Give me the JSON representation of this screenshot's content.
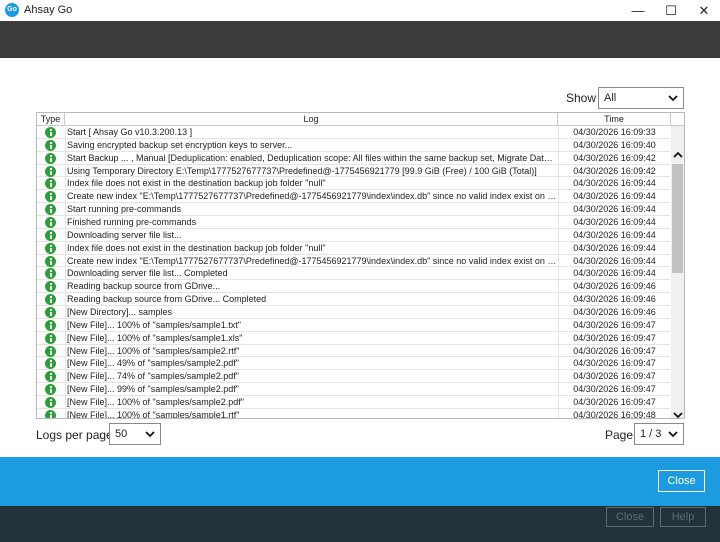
{
  "window": {
    "title": "Ahsay Go",
    "icon_text": "Go",
    "min_glyph": "—",
    "max_glyph": "☐",
    "close_glyph": "✕"
  },
  "filter": {
    "show_label": "Show",
    "show_value": "All"
  },
  "table": {
    "headers": {
      "type": "Type",
      "log": "Log",
      "time": "Time"
    },
    "rows": [
      {
        "message": "Start [ Ahsay Go v10.3.200.13 ]",
        "time": "04/30/2026 16:09:33"
      },
      {
        "message": "Saving encrypted backup set encryption keys to server...",
        "time": "04/30/2026 16:09:40"
      },
      {
        "message": "Start Backup ... , Manual [Deduplication: enabled, Deduplication scope: All files within the same backup set, Migrate Data: ...",
        "time": "04/30/2026 16:09:42"
      },
      {
        "message": "Using Temporary Directory E:\\Temp\\1777527677737\\Predefined@-1775456921779 [99.9 GiB (Free) / 100 GiB (Total)]",
        "time": "04/30/2026 16:09:42"
      },
      {
        "message": "Index file does not exist in the destination backup job folder \"null\"",
        "time": "04/30/2026 16:09:44"
      },
      {
        "message": "Create new index \"E:\\Temp\\1777527677737\\Predefined@-1775456921779\\index\\index.db\" since no valid index exist on b...",
        "time": "04/30/2026 16:09:44"
      },
      {
        "message": "Start running pre-commands",
        "time": "04/30/2026 16:09:44"
      },
      {
        "message": "Finished running pre-commands",
        "time": "04/30/2026 16:09:44"
      },
      {
        "message": "Downloading server file list...",
        "time": "04/30/2026 16:09:44"
      },
      {
        "message": "Index file does not exist in the destination backup job folder \"null\"",
        "time": "04/30/2026 16:09:44"
      },
      {
        "message": "Create new index \"E:\\Temp\\1777527677737\\Predefined@-1775456921779\\index\\index.db\" since no valid index exist on b...",
        "time": "04/30/2026 16:09:44"
      },
      {
        "message": "Downloading server file list... Completed",
        "time": "04/30/2026 16:09:44"
      },
      {
        "message": "Reading backup source from GDrive...",
        "time": "04/30/2026 16:09:46"
      },
      {
        "message": "Reading backup source from GDrive... Completed",
        "time": "04/30/2026 16:09:46"
      },
      {
        "message": "[New Directory]... samples",
        "time": "04/30/2026 16:09:46"
      },
      {
        "message": "[New File]... 100% of \"samples/sample1.txt\"",
        "time": "04/30/2026 16:09:47"
      },
      {
        "message": "[New File]... 100% of \"samples/sample1.xls\"",
        "time": "04/30/2026 16:09:47"
      },
      {
        "message": "[New File]... 100% of \"samples/sample2.rtf\"",
        "time": "04/30/2026 16:09:47"
      },
      {
        "message": "[New File]... 49% of \"samples/sample2.pdf\"",
        "time": "04/30/2026 16:09:47"
      },
      {
        "message": "[New File]... 74% of \"samples/sample2.pdf\"",
        "time": "04/30/2026 16:09:47"
      },
      {
        "message": "[New File]... 99% of \"samples/sample2.pdf\"",
        "time": "04/30/2026 16:09:47"
      },
      {
        "message": "[New File]... 100% of \"samples/sample2.pdf\"",
        "time": "04/30/2026 16:09:47"
      },
      {
        "message": "[New File]... 100% of \"samples/sample1.rtf\"",
        "time": "04/30/2026 16:09:48"
      }
    ]
  },
  "pagination": {
    "logs_per_page_label": "Logs per page",
    "logs_per_page_value": "50",
    "page_label": "Page",
    "page_value": "1 / 3"
  },
  "footer": {
    "close_label": "Close",
    "bg_close_label": "Close",
    "bg_help_label": "Help"
  },
  "colors": {
    "accent": "#1c9be0",
    "topbar": "#3c3c3c",
    "footer": "#24323c",
    "info_icon": "#2e9d3a"
  },
  "icons": [
    "app-logo-icon",
    "minimize-icon",
    "maximize-icon",
    "close-icon",
    "chevron-down-icon",
    "info-icon",
    "scroll-up-icon",
    "scroll-down-icon"
  ]
}
